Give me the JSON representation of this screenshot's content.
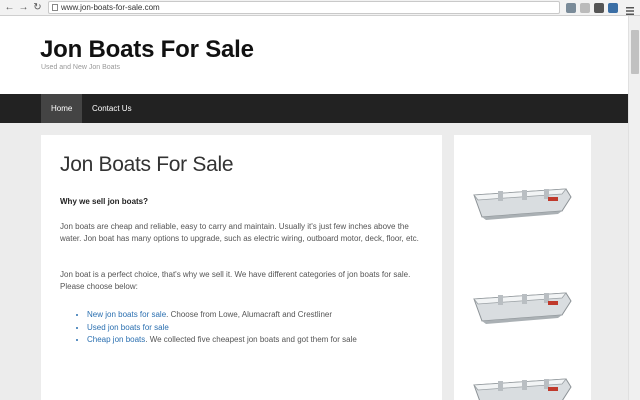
{
  "browser": {
    "url": "www.jon-boats-for-sale.com",
    "back_icon": "←",
    "forward_icon": "→",
    "reload_icon": "↻"
  },
  "site": {
    "title": "Jon Boats For Sale",
    "tagline": "Used and New Jon Boats"
  },
  "menu": {
    "items": [
      {
        "label": "Home"
      },
      {
        "label": "Contact Us"
      }
    ]
  },
  "main": {
    "heading": "Jon Boats For Sale",
    "subheading": "Why we sell jon boats?",
    "para1": "Jon boats  are cheap and reliable, easy to carry and maintain. Usually it's just few inches above the water. Jon boat has many options to upgrade, such as electric wiring, outboard motor, deck, floor, etc.",
    "para2": "Jon boat is a perfect choice, that's why we sell it. We have different categories of jon boats for sale. Please choose below:",
    "list": [
      {
        "link": "New jon boats for sale",
        "rest": ". Choose from Lowe, Alumacraft and Crestliner"
      },
      {
        "link": "Used jon boats for sale",
        "rest": ""
      },
      {
        "link": "Cheap jon boats",
        "rest": ". We collected five cheapest jon boats and got them for sale"
      }
    ]
  },
  "colors": {
    "menubar": "#222222",
    "link": "#2a6fb0",
    "page_bg": "#ececec"
  }
}
